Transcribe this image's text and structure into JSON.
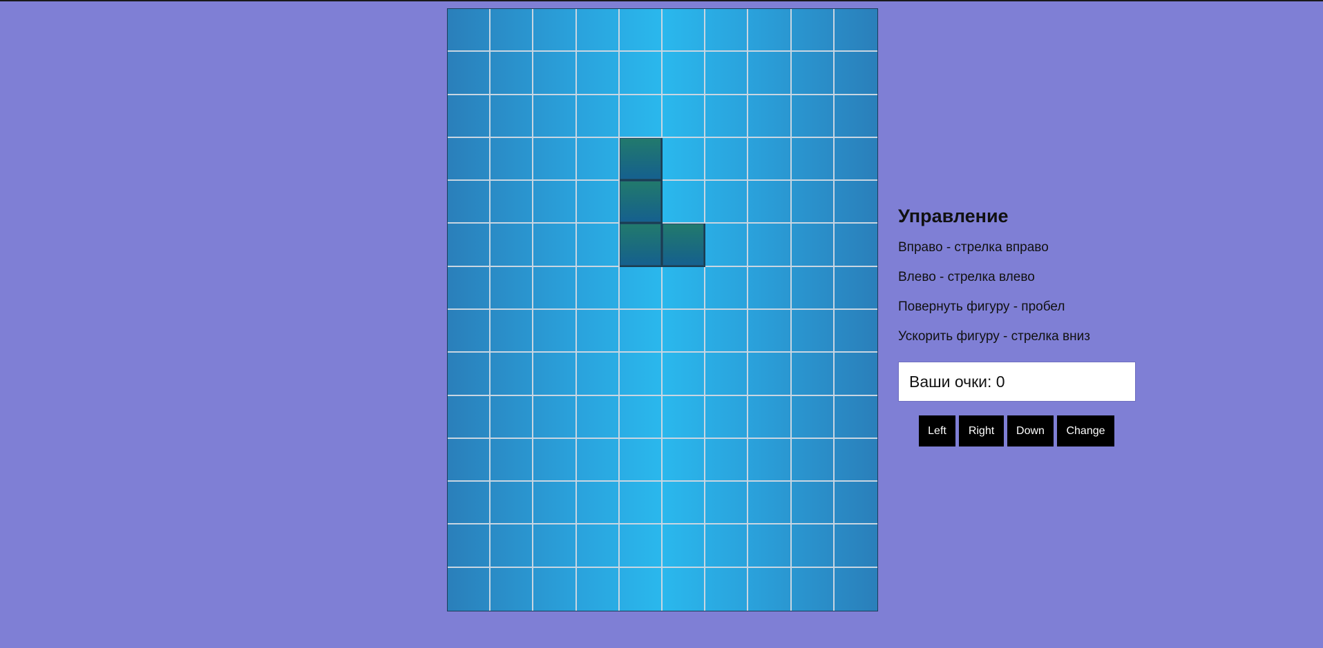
{
  "board": {
    "cols": 10,
    "rows": 14,
    "filled_cells": [
      [
        3,
        4
      ],
      [
        4,
        4
      ],
      [
        5,
        4
      ],
      [
        5,
        5
      ]
    ]
  },
  "controls": {
    "title": "Управление",
    "lines": [
      "Вправо - стрелка вправо",
      "Влево - стрелка влево",
      "Повернуть фигуру - пробел",
      "Ускорить фигуру - стрелка вниз"
    ]
  },
  "score": {
    "text": "Ваши очки: 0"
  },
  "buttons": {
    "left": "Left",
    "right": "Right",
    "down": "Down",
    "change": "Change"
  },
  "colors": {
    "background": "#7f7fd5",
    "board_center": "#2ab8ed",
    "board_edge": "#2a7fba",
    "piece": "#1a6a80",
    "button_bg": "#000000"
  }
}
